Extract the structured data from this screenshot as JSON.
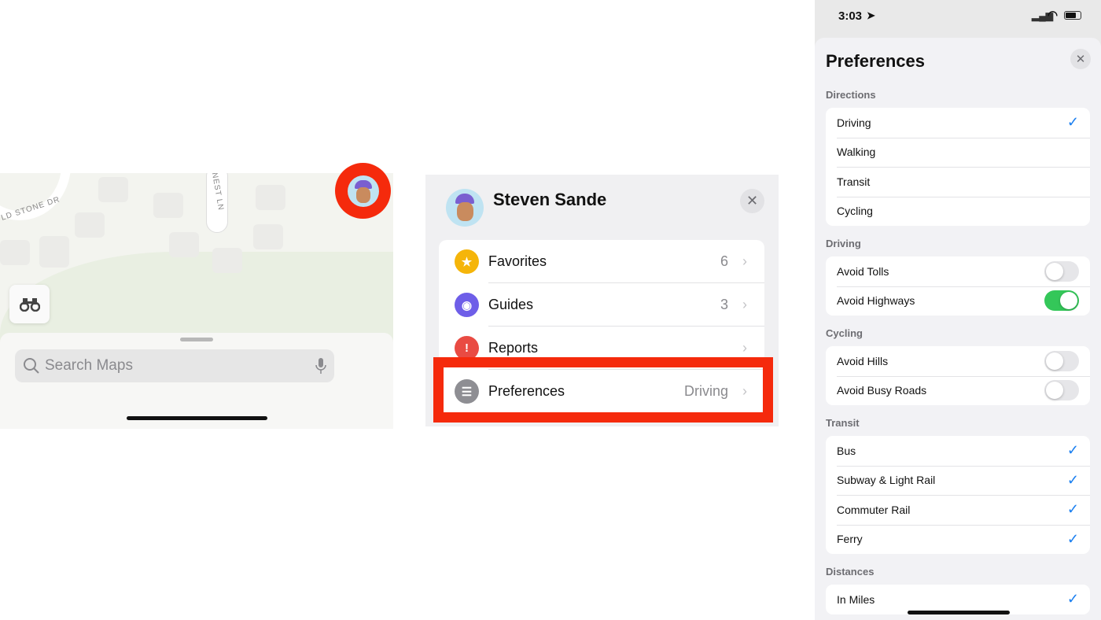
{
  "panel1": {
    "map_labels": [
      "LD STONE DR",
      "NEST LN"
    ],
    "search_placeholder": "Search Maps",
    "icons": [
      "binoculars-icon",
      "search-icon",
      "microphone-icon",
      "avatar"
    ]
  },
  "panel2": {
    "user_name": "Steven Sande",
    "items": [
      {
        "label": "Favorites",
        "value": "6",
        "icon": "star-icon",
        "color": "#f5b50a"
      },
      {
        "label": "Guides",
        "value": "3",
        "icon": "guides-icon",
        "color": "#6e5ee8"
      },
      {
        "label": "Reports",
        "value": "",
        "icon": "report-icon",
        "color": "#e94b43"
      },
      {
        "label": "Preferences",
        "value": "Driving",
        "icon": "preferences-icon",
        "color": "#8e8e93"
      }
    ],
    "highlight_color": "#f52a0c"
  },
  "panel3": {
    "time": "3:03",
    "title": "Preferences",
    "sections": [
      {
        "header": "Directions",
        "rows": [
          {
            "label": "Driving",
            "check": true
          },
          {
            "label": "Walking",
            "check": false
          },
          {
            "label": "Transit",
            "check": false
          },
          {
            "label": "Cycling",
            "check": false
          }
        ]
      },
      {
        "header": "Driving",
        "rows": [
          {
            "label": "Avoid Tolls",
            "toggle": false
          },
          {
            "label": "Avoid Highways",
            "toggle": true
          }
        ]
      },
      {
        "header": "Cycling",
        "rows": [
          {
            "label": "Avoid Hills",
            "toggle": false
          },
          {
            "label": "Avoid Busy Roads",
            "toggle": false
          }
        ]
      },
      {
        "header": "Transit",
        "rows": [
          {
            "label": "Bus",
            "check": true
          },
          {
            "label": "Subway & Light Rail",
            "check": true
          },
          {
            "label": "Commuter Rail",
            "check": true
          },
          {
            "label": "Ferry",
            "check": true
          }
        ]
      },
      {
        "header": "Distances",
        "rows": [
          {
            "label": "In Miles",
            "check": true
          }
        ]
      }
    ],
    "checkmark": "✓",
    "accent": "#1a7ff0",
    "toggle_on_color": "#34c759"
  }
}
